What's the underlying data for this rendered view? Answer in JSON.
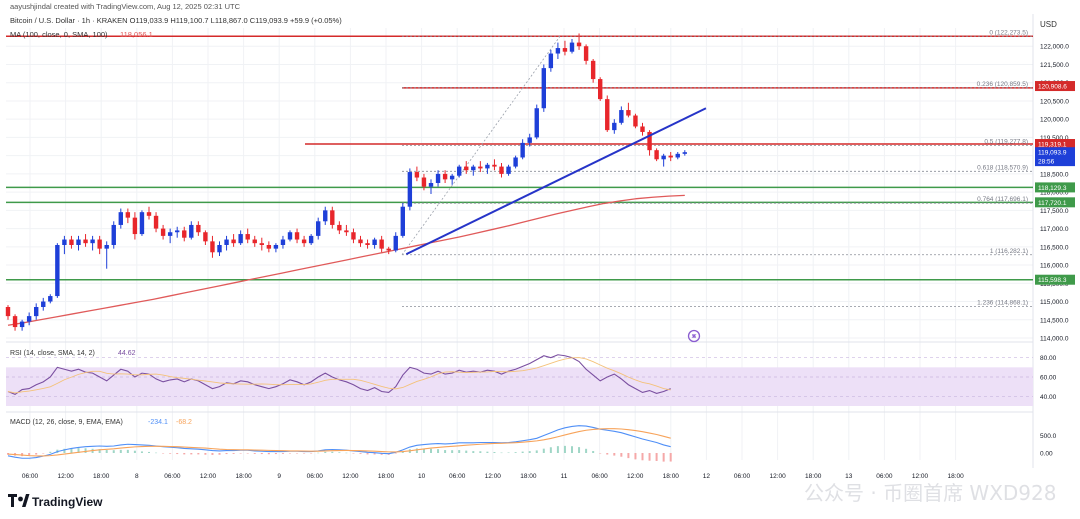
{
  "header": {
    "created_by": "aayushjindal created with TradingView.com, Aug 12, 2025 02:31 UTC",
    "symbol_line": "Bitcoin / U.S. Dollar · 1h · KRAKEN  O119,033.9  H119,100.7  L118,867.0  C119,093.9  +59.9 (+0.05%)",
    "ma_line": "MA (100, close, 0, SMA, 100)",
    "ma_value": "118,056.1"
  },
  "currency": "USD",
  "brand": "TradingView",
  "watermark": "公众号 · 币圈首席 WXD928",
  "colors": {
    "up": "#1e3fd8",
    "down": "#e8262b",
    "ma": "#e05a5a",
    "trendline": "#2634c8",
    "resistance": "#d42a2a",
    "support": "#3f9a4a",
    "fib": "#8a8e98",
    "rsi_band": "#ede0f7",
    "rsi_line": "#7a4fa0",
    "macd_line": "#4f8ff7",
    "signal_line": "#f7a35a"
  },
  "chart_data": {
    "type": "candlestick",
    "y_range": [
      114000,
      122500
    ],
    "y_ticks": [
      {
        "v": 122000,
        "t": "122,000.0"
      },
      {
        "v": 121500,
        "t": "121,500.0"
      },
      {
        "v": 121000,
        "t": "121,000.0"
      },
      {
        "v": 120500,
        "t": "120,500.0"
      },
      {
        "v": 120000,
        "t": "120,000.0"
      },
      {
        "v": 119500,
        "t": "119,500.0"
      },
      {
        "v": 119000,
        "t": "119,000.0"
      },
      {
        "v": 118500,
        "t": "118,500.0"
      },
      {
        "v": 118000,
        "t": "118,000.0"
      },
      {
        "v": 117500,
        "t": "117,500.0"
      },
      {
        "v": 117000,
        "t": "117,000.0"
      },
      {
        "v": 116500,
        "t": "116,500.0"
      },
      {
        "v": 116000,
        "t": "116,000.0"
      },
      {
        "v": 115500,
        "t": "115,500.0"
      },
      {
        "v": 115000,
        "t": "115,000.0"
      },
      {
        "v": 114500,
        "t": "114,500.0"
      },
      {
        "v": 114000,
        "t": "114,000.0"
      }
    ],
    "x_ticks": [
      "06:00",
      "12:00",
      "18:00",
      "8",
      "06:00",
      "12:00",
      "18:00",
      "9",
      "06:00",
      "12:00",
      "18:00",
      "10",
      "06:00",
      "12:00",
      "18:00",
      "11",
      "06:00",
      "12:00",
      "18:00",
      "12",
      "06:00",
      "12:00",
      "18:00",
      "13",
      "06:00",
      "12:00",
      "18:00"
    ],
    "candles": [
      [
        114850,
        114900,
        114500,
        114600
      ],
      [
        114600,
        114650,
        114200,
        114300
      ],
      [
        114300,
        114500,
        114200,
        114450
      ],
      [
        114450,
        114700,
        114350,
        114600
      ],
      [
        114600,
        114950,
        114500,
        114850
      ],
      [
        114850,
        115100,
        114750,
        115000
      ],
      [
        115000,
        115200,
        114950,
        115150
      ],
      [
        115150,
        116600,
        115100,
        116550
      ],
      [
        116550,
        116800,
        116300,
        116700
      ],
      [
        116700,
        116800,
        116450,
        116550
      ],
      [
        116550,
        116800,
        116400,
        116700
      ],
      [
        116700,
        116850,
        116500,
        116600
      ],
      [
        116600,
        116800,
        116400,
        116700
      ],
      [
        116700,
        116800,
        116300,
        116450
      ],
      [
        116450,
        116650,
        115900,
        116550
      ],
      [
        116550,
        117200,
        116450,
        117100
      ],
      [
        117100,
        117550,
        117000,
        117450
      ],
      [
        117450,
        117550,
        117150,
        117300
      ],
      [
        117300,
        117450,
        116700,
        116850
      ],
      [
        116850,
        117500,
        116800,
        117450
      ],
      [
        117450,
        117600,
        117250,
        117350
      ],
      [
        117350,
        117450,
        116900,
        117000
      ],
      [
        117000,
        117100,
        116700,
        116800
      ],
      [
        116800,
        117000,
        116600,
        116900
      ],
      [
        116900,
        117050,
        116750,
        116950
      ],
      [
        116950,
        117050,
        116650,
        116750
      ],
      [
        116750,
        117200,
        116700,
        117100
      ],
      [
        117100,
        117200,
        116800,
        116900
      ],
      [
        116900,
        116950,
        116550,
        116650
      ],
      [
        116650,
        116800,
        116200,
        116350
      ],
      [
        116350,
        116650,
        116250,
        116550
      ],
      [
        116550,
        116800,
        116400,
        116700
      ],
      [
        116700,
        116850,
        116500,
        116600
      ],
      [
        116600,
        116950,
        116550,
        116850
      ],
      [
        116850,
        117000,
        116600,
        116700
      ],
      [
        116700,
        116800,
        116500,
        116600
      ],
      [
        116600,
        116750,
        116400,
        116550
      ],
      [
        116550,
        116650,
        116350,
        116450
      ],
      [
        116450,
        116600,
        116350,
        116550
      ],
      [
        116550,
        116800,
        116450,
        116700
      ],
      [
        116700,
        116950,
        116650,
        116900
      ],
      [
        116900,
        117000,
        116600,
        116700
      ],
      [
        116700,
        116800,
        116500,
        116600
      ],
      [
        116600,
        116850,
        116550,
        116800
      ],
      [
        116800,
        117300,
        116700,
        117200
      ],
      [
        117200,
        117600,
        117100,
        117500
      ],
      [
        117500,
        117600,
        117000,
        117100
      ],
      [
        117100,
        117200,
        116850,
        116950
      ],
      [
        116950,
        117100,
        116800,
        116900
      ],
      [
        116900,
        117000,
        116600,
        116700
      ],
      [
        116700,
        116800,
        116500,
        116600
      ],
      [
        116600,
        116700,
        116450,
        116550
      ],
      [
        116550,
        116750,
        116450,
        116700
      ],
      [
        116700,
        116800,
        116350,
        116450
      ],
      [
        116450,
        116500,
        116300,
        116400
      ],
      [
        116400,
        116900,
        116350,
        116800
      ],
      [
        116800,
        117700,
        116750,
        117600
      ],
      [
        117600,
        118650,
        117500,
        118550
      ],
      [
        118550,
        118700,
        118300,
        118400
      ],
      [
        118400,
        118500,
        118050,
        118150
      ],
      [
        118150,
        118350,
        117950,
        118250
      ],
      [
        118250,
        118600,
        118150,
        118500
      ],
      [
        118500,
        118600,
        118250,
        118350
      ],
      [
        118350,
        118500,
        118200,
        118450
      ],
      [
        118450,
        118750,
        118400,
        118700
      ],
      [
        118700,
        118850,
        118500,
        118600
      ],
      [
        118600,
        118750,
        118450,
        118700
      ],
      [
        118700,
        118850,
        118550,
        118650
      ],
      [
        118650,
        118800,
        118500,
        118750
      ],
      [
        118750,
        118900,
        118600,
        118700
      ],
      [
        118700,
        118800,
        118400,
        118500
      ],
      [
        118500,
        118750,
        118450,
        118700
      ],
      [
        118700,
        119000,
        118650,
        118950
      ],
      [
        118950,
        119450,
        118900,
        119350
      ],
      [
        119350,
        119600,
        119250,
        119500
      ],
      [
        119500,
        120400,
        119450,
        120300
      ],
      [
        120300,
        121500,
        120200,
        121400
      ],
      [
        121400,
        121900,
        121300,
        121800
      ],
      [
        121800,
        122100,
        121650,
        121950
      ],
      [
        121950,
        122150,
        121750,
        121850
      ],
      [
        121850,
        122200,
        121800,
        122100
      ],
      [
        122100,
        122350,
        121900,
        122000
      ],
      [
        122000,
        122050,
        121500,
        121600
      ],
      [
        121600,
        121650,
        121000,
        121100
      ],
      [
        121100,
        121150,
        120500,
        120550
      ],
      [
        120550,
        120650,
        119650,
        119700
      ],
      [
        119700,
        120000,
        119600,
        119900
      ],
      [
        119900,
        120350,
        119850,
        120250
      ],
      [
        120250,
        120450,
        120050,
        120100
      ],
      [
        120100,
        120150,
        119750,
        119800
      ],
      [
        119800,
        119900,
        119550,
        119650
      ],
      [
        119650,
        119700,
        119000,
        119150
      ],
      [
        119150,
        119200,
        118850,
        118900
      ],
      [
        118900,
        119050,
        118700,
        119000
      ],
      [
        119000,
        119100,
        118850,
        118950
      ],
      [
        118950,
        119100,
        118900,
        119050
      ],
      [
        119050,
        119150,
        119000,
        119094
      ]
    ],
    "ma_line": [
      114350,
      114420,
      114500,
      114580,
      114660,
      114740,
      114820,
      114900,
      114980,
      115060,
      115150,
      115240,
      115330,
      115420,
      115510,
      115600,
      115690,
      115780,
      115870,
      115960,
      116050,
      116140,
      116230,
      116320,
      116410,
      116500,
      116590,
      116680,
      116770,
      116870,
      116970,
      117070,
      117180,
      117290,
      117400,
      117500,
      117600,
      117690,
      117760,
      117820,
      117860,
      117890,
      117910
    ],
    "trendline": [
      [
        56.5,
        116300
      ],
      [
        99,
        120300
      ]
    ],
    "levels": {
      "resistance": [
        122273.5,
        120859.5,
        119319.1
      ],
      "support": [
        118129.3,
        117720.1,
        115598.3
      ]
    },
    "price_tags": [
      {
        "v": 120908.6,
        "t": "120,908.6",
        "kind": "resistance"
      },
      {
        "v": 119319.1,
        "t": "119,319.1",
        "kind": "resistance"
      },
      {
        "v": 119093.9,
        "t": "119,093.9",
        "kind": "current"
      },
      {
        "v": 118850,
        "t": "28:56",
        "kind": "current"
      },
      {
        "v": 118129.3,
        "t": "118,129.3",
        "kind": "support"
      },
      {
        "v": 117720.1,
        "t": "117,720.1",
        "kind": "support"
      },
      {
        "v": 115598.3,
        "t": "115,598.3",
        "kind": "support"
      }
    ],
    "fib": [
      {
        "r": "0",
        "v": 122273.5,
        "t": "0 (122,273.5)"
      },
      {
        "r": "0.236",
        "v": 120859.5,
        "t": "0.236 (120,859.5)"
      },
      {
        "r": "0.5",
        "v": 119277.8,
        "t": "0.5 (119,277.8)"
      },
      {
        "r": "0.618",
        "v": 118570.9,
        "t": "0.618 (118,570.9)"
      },
      {
        "r": "0.764",
        "v": 117696.1,
        "t": "0.764 (117,696.1)"
      },
      {
        "r": "1",
        "v": 116282.1,
        "t": "1 (116,282.1)"
      },
      {
        "r": "1.236",
        "v": 114868.1,
        "t": "1.236 (114,868.1)"
      }
    ],
    "rsi": {
      "label": "RSI (14, close, SMA, 14, 2)",
      "value": "44.62",
      "y_ticks": [
        80,
        60,
        40
      ],
      "y_tick_labels": [
        "80.00",
        "60.00",
        "40.00"
      ],
      "band": [
        30,
        70
      ],
      "values": [
        45,
        42,
        47,
        48,
        52,
        55,
        60,
        70,
        68,
        66,
        68,
        65,
        64,
        60,
        56,
        62,
        68,
        66,
        60,
        64,
        63,
        58,
        55,
        57,
        58,
        55,
        58,
        56,
        52,
        48,
        50,
        54,
        53,
        56,
        55,
        52,
        50,
        48,
        50,
        53,
        57,
        55,
        52,
        55,
        60,
        64,
        60,
        57,
        55,
        52,
        48,
        46,
        49,
        45,
        44,
        50,
        62,
        70,
        68,
        64,
        63,
        66,
        63,
        64,
        67,
        65,
        66,
        65,
        67,
        66,
        63,
        66,
        68,
        71,
        74,
        78,
        82,
        80,
        83,
        82,
        80,
        76,
        68,
        62,
        56,
        60,
        63,
        58,
        52,
        48,
        44,
        46,
        43,
        45,
        48
      ]
    },
    "macd": {
      "label": "MACD (12, 26, close, 9, EMA, EMA)",
      "value1": "-234.1",
      "value2": "-68.2",
      "y_ticks": [
        500,
        0
      ],
      "y_tick_labels": [
        "500.0",
        "0.00"
      ],
      "macd": [
        -80,
        -120,
        -150,
        -150,
        -130,
        -90,
        -40,
        40,
        90,
        130,
        160,
        180,
        190,
        200,
        190,
        200,
        230,
        250,
        240,
        230,
        220,
        200,
        180,
        165,
        150,
        130,
        120,
        110,
        90,
        70,
        60,
        70,
        70,
        80,
        80,
        60,
        50,
        40,
        40,
        40,
        50,
        50,
        40,
        40,
        60,
        90,
        100,
        90,
        80,
        60,
        40,
        20,
        10,
        -10,
        -20,
        20,
        90,
        170,
        220,
        240,
        260,
        270,
        260,
        270,
        290,
        290,
        290,
        300,
        300,
        300,
        290,
        300,
        320,
        350,
        380,
        420,
        500,
        580,
        660,
        720,
        760,
        780,
        770,
        730,
        680,
        650,
        620,
        580,
        520,
        460,
        400,
        350,
        300,
        230,
        180
      ],
      "signal": [
        -30,
        -45,
        -60,
        -75,
        -85,
        -85,
        -75,
        -55,
        -30,
        -5,
        20,
        45,
        70,
        90,
        105,
        120,
        140,
        160,
        175,
        185,
        190,
        190,
        190,
        185,
        180,
        170,
        160,
        150,
        140,
        125,
        110,
        100,
        95,
        90,
        90,
        85,
        80,
        75,
        70,
        65,
        60,
        60,
        55,
        52,
        52,
        58,
        65,
        70,
        72,
        70,
        66,
        60,
        52,
        42,
        32,
        30,
        42,
        62,
        90,
        115,
        140,
        160,
        176,
        190,
        206,
        222,
        236,
        250,
        262,
        272,
        278,
        286,
        296,
        310,
        326,
        346,
        376,
        416,
        464,
        516,
        566,
        612,
        650,
        674,
        688,
        694,
        694,
        686,
        666,
        640,
        608,
        570,
        528,
        476,
        424
      ]
    }
  }
}
